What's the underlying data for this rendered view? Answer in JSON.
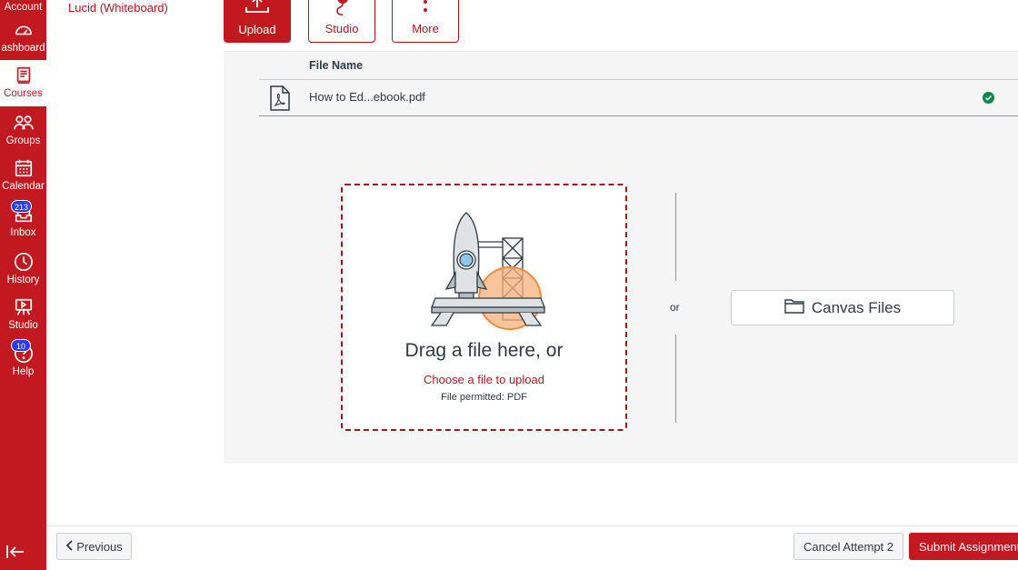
{
  "global_nav": {
    "items": [
      {
        "label": "Account",
        "icon": "account-icon"
      },
      {
        "label": "ashboard",
        "icon": "dashboard-icon"
      },
      {
        "label": "Courses",
        "icon": "courses-icon"
      },
      {
        "label": "Groups",
        "icon": "groups-icon"
      },
      {
        "label": "Calendar",
        "icon": "calendar-icon"
      },
      {
        "label": "Inbox",
        "icon": "inbox-icon",
        "badge": "213"
      },
      {
        "label": "History",
        "icon": "history-icon"
      },
      {
        "label": "Studio",
        "icon": "studio-icon"
      },
      {
        "label": "Help",
        "icon": "help-icon",
        "badge": "10"
      }
    ],
    "active": "Courses"
  },
  "course_nav": {
    "lucid_link": "Lucid (Whiteboard)"
  },
  "toolbar": {
    "upload": "Upload",
    "studio": "Studio",
    "more": "More"
  },
  "files_table": {
    "header": "File Name",
    "rows": [
      {
        "name": "How to Ed...ebook.pdf",
        "status": "uploaded"
      }
    ]
  },
  "dropzone": {
    "title": "Drag a file here, or",
    "link": "Choose a file to upload",
    "permitted": "File permitted: PDF"
  },
  "or_text": "or",
  "canvas_files": "Canvas Files",
  "footer": {
    "previous": "Previous",
    "cancel": "Cancel Attempt 2",
    "submit": "Submit Assignment"
  },
  "colors": {
    "brand": "#c1191f",
    "link": "#b4151b",
    "badge": "#2b3ce6",
    "success": "#0b874b"
  }
}
